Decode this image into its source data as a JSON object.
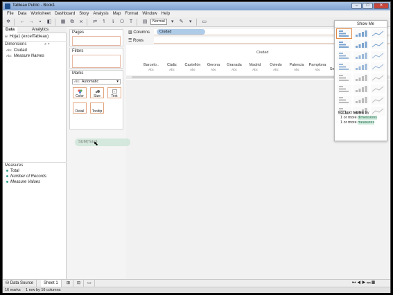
{
  "window": {
    "title": "Tableau Public - Book1",
    "min": "–",
    "max": "□",
    "close": "✕"
  },
  "menu": [
    "File",
    "Data",
    "Worksheet",
    "Dashboard",
    "Story",
    "Analysis",
    "Map",
    "Format",
    "Window",
    "Help"
  ],
  "toolbar": {
    "fit_value": "Normal"
  },
  "left": {
    "tabs": [
      "Data",
      "Analytics"
    ],
    "datasource": "Hoja1 (excelTableau)",
    "dimensions_label": "Dimensions",
    "dimensions": [
      "Ciudad",
      "Measure Names"
    ],
    "measures_label": "Measures",
    "measures": [
      "Total",
      "Number of Records",
      "Measure Values"
    ]
  },
  "cards": {
    "pages": "Pages",
    "filters": "Filters",
    "marks": "Marks"
  },
  "marks": {
    "type": "Automatic",
    "buttons": [
      "Color",
      "Size",
      "Text",
      "Detail",
      "Tooltip"
    ]
  },
  "shelves": {
    "columns_label": "Columns",
    "rows_label": "Rows",
    "columns_pill": "Ciudad"
  },
  "view": {
    "header_title": "Ciudad",
    "columns": [
      "Barcelo..",
      "Cádiz",
      "Castellón",
      "Gerona",
      "Granada",
      "Madrid",
      "Oviedo",
      "Palencia",
      "Pamplona",
      "San Sebastián"
    ],
    "cell_placeholder": "Abc"
  },
  "drag_pill": "SUM(Total)",
  "showme": {
    "title": "Show Me",
    "hint_prefix": "For ",
    "hint_bold": "text tables",
    "hint_suffix": " try",
    "line1_prefix": "1 or more ",
    "line1_hl": "dimensions",
    "line2_prefix": "1 or more ",
    "line2_hl": "measures"
  },
  "bottom": {
    "tabs": [
      "Data Source",
      "Sheet 1"
    ]
  },
  "status": {
    "marks": "16 marks",
    "dims": "1 row by 16 columns"
  }
}
